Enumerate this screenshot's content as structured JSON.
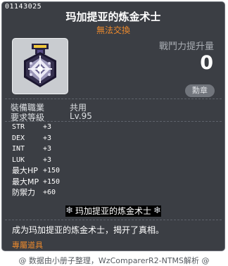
{
  "item_id": "01143025",
  "title": "玛加提亚的炼金术士",
  "subtitle": "無法交換",
  "power": {
    "label": "戰鬥力提升量",
    "value": "0"
  },
  "badge_button": "勳章",
  "job": {
    "label": "裝備職業",
    "value": "共用"
  },
  "level": {
    "label": "要求等級",
    "value": "Lv.95"
  },
  "stats": [
    {
      "name": "STR",
      "value": "+3"
    },
    {
      "name": "DEX",
      "value": "+3"
    },
    {
      "name": "INT",
      "value": "+3"
    },
    {
      "name": "LUK",
      "value": "+3"
    },
    {
      "name": "最大HP",
      "value": "+150"
    },
    {
      "name": "最大MP",
      "value": "+150"
    },
    {
      "name": "防禦力",
      "value": "+60"
    }
  ],
  "set_name": "玛加提亚的炼金术士",
  "description": "成为玛加提亚的炼金术士，揭开了真相。",
  "exclusive": "專屬道具",
  "footer": "@ 数据由小册子整理，WzComparerR2-NTMS解析 @",
  "icon_name": "alchemist-medal-icon"
}
